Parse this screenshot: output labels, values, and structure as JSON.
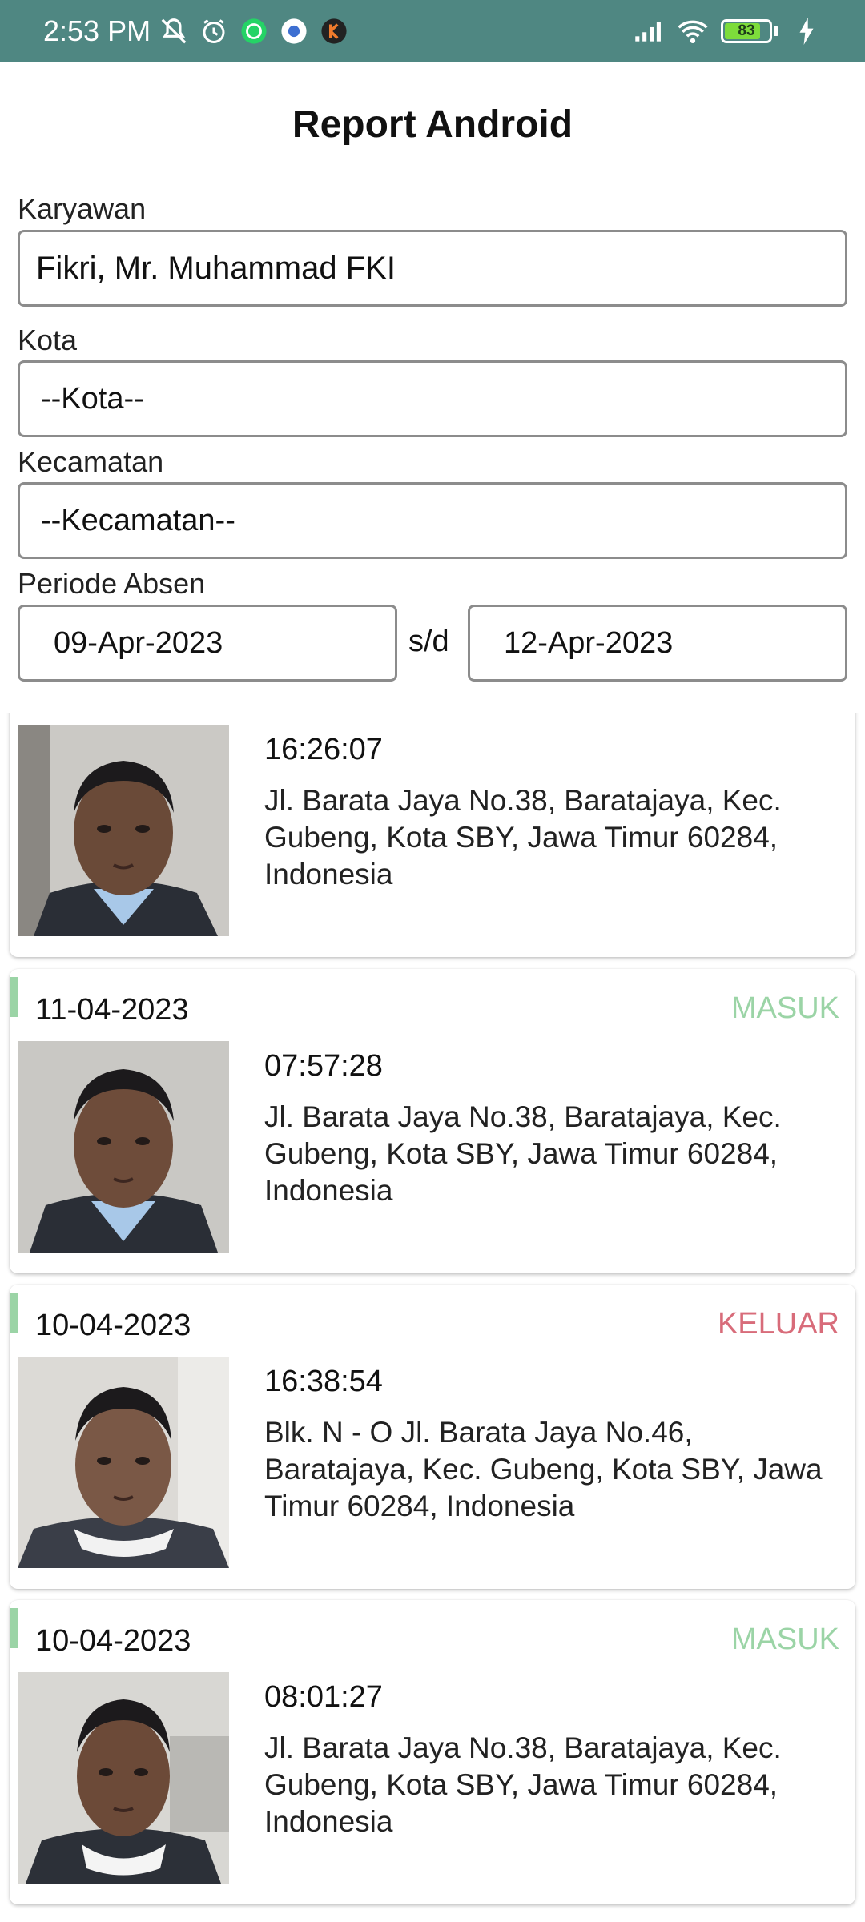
{
  "status_bar": {
    "time": "2:53 PM",
    "battery": "83",
    "battery_level_percent": 83,
    "left_icons": [
      "mute-icon",
      "alarm-icon",
      "whatsapp-icon",
      "settings-app-icon",
      "app-k-icon"
    ],
    "right_icons": [
      "signal-icon",
      "wifi-icon",
      "battery-icon",
      "charging-icon"
    ]
  },
  "page": {
    "title": "Report Android"
  },
  "form": {
    "karyawan_label": "Karyawan",
    "karyawan_value": "Fikri, Mr. Muhammad FKI",
    "kota_label": "Kota",
    "kota_value": "--Kota--",
    "kecamatan_label": "Kecamatan",
    "kecamatan_value": "--Kecamatan--",
    "periode_label": "Periode Absen",
    "date_from": "09-Apr-2023",
    "separator": "s/d",
    "date_to": "12-Apr-2023"
  },
  "records": [
    {
      "date": "",
      "status": "",
      "time": "16:26:07",
      "address": "Jl. Barata Jaya No.38, Baratajaya, Kec. Gubeng, Kota SBY, Jawa Timur 60284, Indonesia"
    },
    {
      "date": "11-04-2023",
      "status": "MASUK",
      "time": "07:57:28",
      "address": "Jl. Barata Jaya No.38, Baratajaya, Kec. Gubeng, Kota SBY, Jawa Timur 60284, Indonesia"
    },
    {
      "date": "10-04-2023",
      "status": "KELUAR",
      "time": "16:38:54",
      "address": "Blk. N - O Jl. Barata Jaya No.46, Baratajaya, Kec. Gubeng, Kota SBY, Jawa Timur 60284, Indonesia"
    },
    {
      "date": "10-04-2023",
      "status": "MASUK",
      "time": "08:01:27",
      "address": "Jl. Barata Jaya No.38, Baratajaya, Kec. Gubeng, Kota SBY, Jawa Timur 60284, Indonesia"
    }
  ],
  "colors": {
    "status_bar": "#4f8782",
    "masuk": "#9bd4a6",
    "keluar": "#d86c7a",
    "accent": "#9bd4a6"
  }
}
